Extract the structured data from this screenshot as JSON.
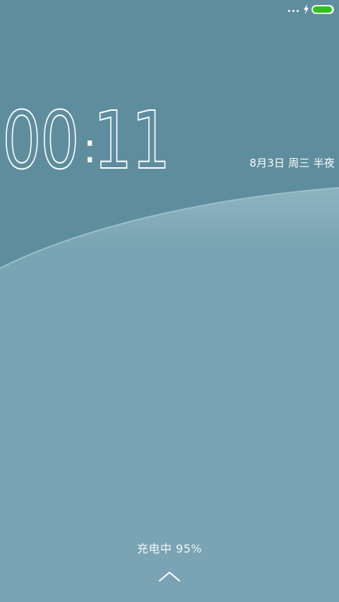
{
  "colors": {
    "background_top": "#5e8e9d",
    "background_bottom": "#7aa4b3",
    "battery_fill": "#31c21c",
    "text": "#ffffff"
  },
  "status_bar": {
    "icons": [
      "more-dots-icon",
      "charging-bolt-icon",
      "battery-icon"
    ],
    "battery_level": 0.95
  },
  "clock": {
    "hours": "00",
    "separator": ":",
    "minutes": "11"
  },
  "date": {
    "text": "8月3日 周三 半夜"
  },
  "charging": {
    "text": "充电中 95%"
  },
  "unlock": {
    "icon": "chevron-up-icon"
  }
}
